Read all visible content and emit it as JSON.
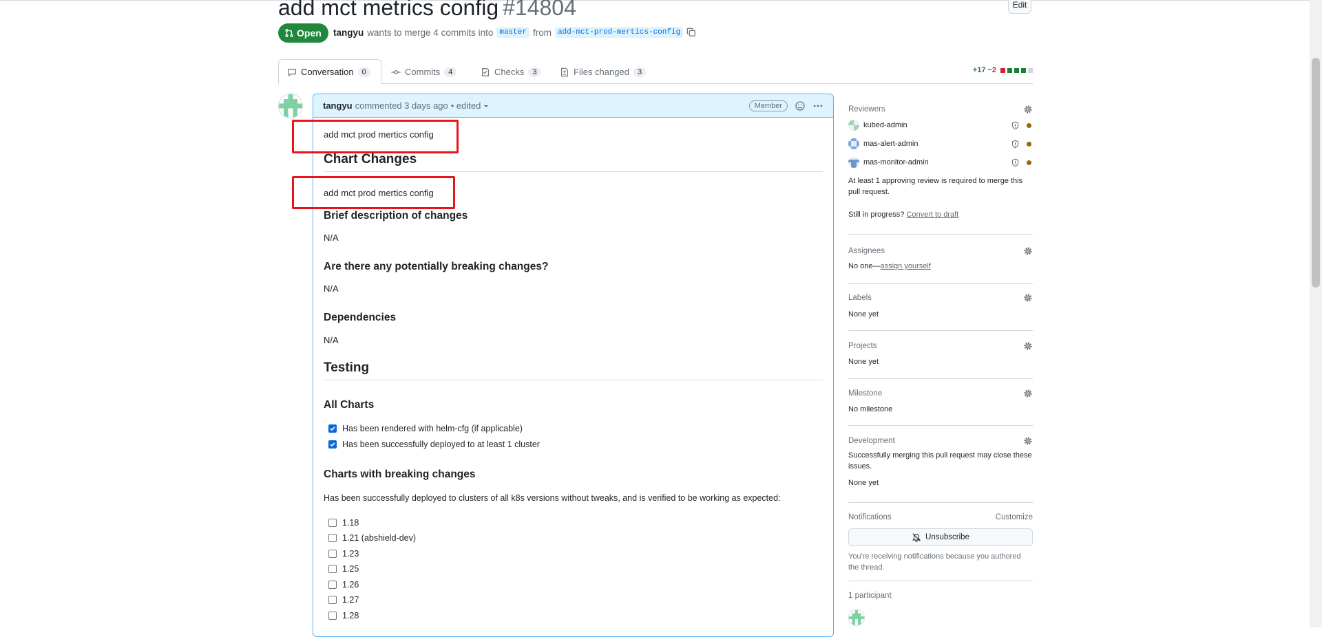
{
  "pr": {
    "title": "add mct metrics config",
    "number": "#14804",
    "edit_label": "Edit",
    "state": "Open",
    "author": "tangyu",
    "meta_text": "wants to merge 4 commits into",
    "base_branch": "master",
    "from_text": "from",
    "head_branch": "add-mct-prod-mertics-config"
  },
  "tabs": [
    {
      "label": "Conversation",
      "count": "0"
    },
    {
      "label": "Commits",
      "count": "4"
    },
    {
      "label": "Checks",
      "count": "3"
    },
    {
      "label": "Files changed",
      "count": "3"
    }
  ],
  "diffstat": {
    "additions": "+17",
    "deletions": "−2"
  },
  "comment": {
    "author": "tangyu",
    "action": "commented 3 days ago",
    "edited": "• edited",
    "role_badge": "Member",
    "body": {
      "intro": "add mct prod mertics config",
      "h_chart_changes": "Chart Changes",
      "chart_changes_text": "add mct prod mertics config",
      "h_brief": "Brief description of changes",
      "brief_text": "N/A",
      "h_breaking": "Are there any potentially breaking changes?",
      "breaking_text": "N/A",
      "h_dependencies": "Dependencies",
      "dependencies_text": "N/A",
      "h_testing": "Testing",
      "h_all_charts": "All Charts",
      "all_charts_checks": [
        {
          "label": "Has been rendered with helm-cfg (if applicable)",
          "checked": true
        },
        {
          "label": "Has been successfully deployed to at least 1 cluster",
          "checked": true
        }
      ],
      "h_breaking_charts": "Charts with breaking changes",
      "breaking_charts_text": "Has been successfully deployed to clusters of all k8s versions without tweaks, and is verified to be working as expected:",
      "k8s_versions": [
        {
          "label": "1.18",
          "checked": false
        },
        {
          "label": "1.21 (abshield-dev)",
          "checked": false
        },
        {
          "label": "1.23",
          "checked": false
        },
        {
          "label": "1.25",
          "checked": false
        },
        {
          "label": "1.26",
          "checked": false
        },
        {
          "label": "1.27",
          "checked": false
        },
        {
          "label": "1.28",
          "checked": false
        }
      ]
    }
  },
  "sidebar": {
    "reviewers": {
      "title": "Reviewers",
      "list": [
        "kubed-admin",
        "mas-alert-admin",
        "mas-monitor-admin"
      ],
      "note": "At least 1 approving review is required to merge this pull request.",
      "progress_q": "Still in progress?",
      "convert_link": "Convert to draft"
    },
    "assignees": {
      "title": "Assignees",
      "text": "No one—",
      "link": "assign yourself"
    },
    "labels": {
      "title": "Labels",
      "text": "None yet"
    },
    "projects": {
      "title": "Projects",
      "text": "None yet"
    },
    "milestone": {
      "title": "Milestone",
      "text": "No milestone"
    },
    "development": {
      "title": "Development",
      "text": "Successfully merging this pull request may close these issues.",
      "value": "None yet"
    },
    "notifications": {
      "title": "Notifications",
      "customize": "Customize",
      "button": "Unsubscribe",
      "note": "You're receiving notifications because you authored the thread."
    },
    "participants": {
      "title": "1 participant"
    }
  },
  "colors": {
    "accent": "#0969da",
    "open_green": "#1f883d",
    "highlight_red": "#e8141b"
  }
}
